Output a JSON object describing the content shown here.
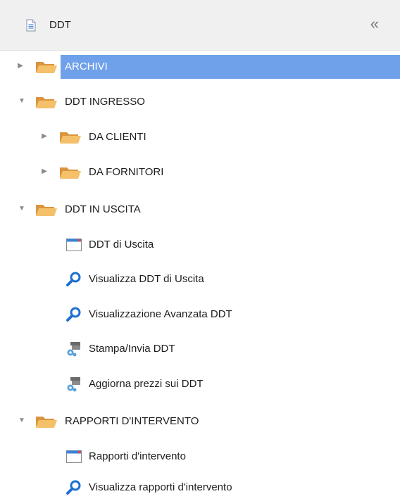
{
  "header": {
    "title": "DDT",
    "collapse_glyph": "«",
    "icon": "document-icon"
  },
  "tree": {
    "archivi": {
      "label": "ARCHIVI",
      "expanded": false,
      "selected": true
    },
    "ingresso": {
      "label": "DDT INGRESSO",
      "expanded": true
    },
    "da_clienti": {
      "label": "DA CLIENTI",
      "expanded": false
    },
    "da_fornitori": {
      "label": "DA FORNITORI",
      "expanded": false
    },
    "uscita": {
      "label": "DDT IN USCITA",
      "expanded": true
    },
    "ddt_uscita": {
      "label": "DDT di Uscita",
      "icon": "window-icon"
    },
    "visualizza_ddt": {
      "label": "Visualizza DDT di Uscita",
      "icon": "search-icon"
    },
    "vis_avanzata": {
      "label": "Visualizzazione Avanzata DDT",
      "icon": "search-icon"
    },
    "stampa": {
      "label": "Stampa/Invia DDT",
      "icon": "process-icon"
    },
    "aggiorna": {
      "label": "Aggiorna prezzi sui DDT",
      "icon": "process-icon"
    },
    "rapporti_folder": {
      "label": "RAPPORTI D'INTERVENTO",
      "expanded": true
    },
    "rapporti": {
      "label": "Rapporti d'intervento",
      "icon": "window-icon"
    },
    "vis_rapporti": {
      "label": "Visualizza rapporti d'intervento",
      "icon": "search-icon"
    }
  },
  "colors": {
    "selection": "#6fa0ea",
    "folder": "#f2b45a",
    "search_icon": "#1f6fd1",
    "window_bar": "#3b82d8"
  }
}
